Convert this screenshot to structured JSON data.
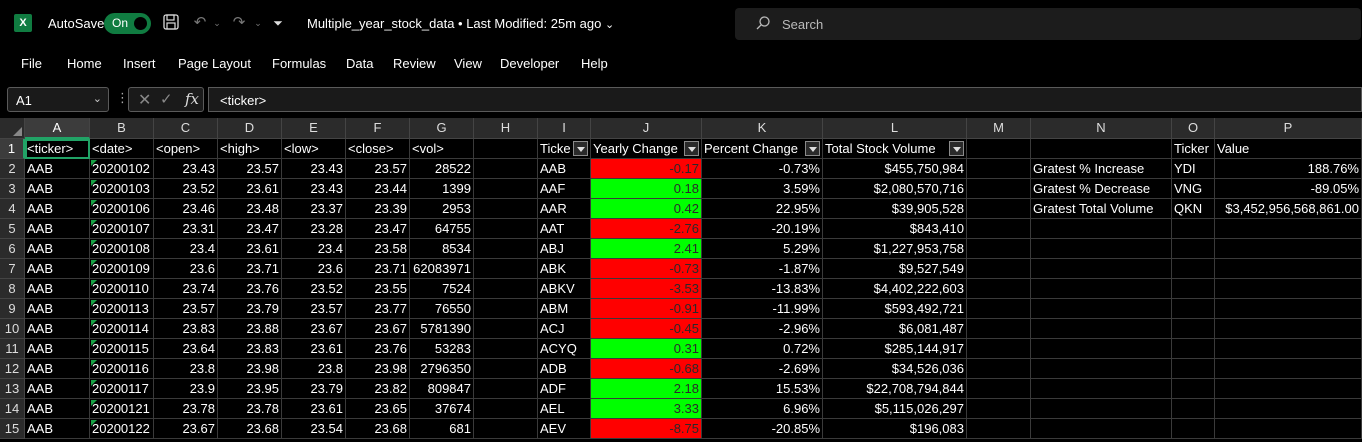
{
  "titlebar": {
    "app_logo": "X",
    "autosave_label": "AutoSave",
    "autosave_state": "On",
    "doc_title": "Multiple_year_stock_data • Last Modified: 25m ago",
    "search_placeholder": "Search",
    "icons": [
      "excel-logo",
      "save-icon",
      "undo-icon",
      "redo-icon",
      "customize-qat-icon",
      "search-icon"
    ]
  },
  "menu": [
    "File",
    "Home",
    "Insert",
    "Page Layout",
    "Formulas",
    "Data",
    "Review",
    "View",
    "Developer",
    "Help"
  ],
  "formula_bar": {
    "name_box": "A1",
    "formula": "<ticker>"
  },
  "grid": {
    "columns": [
      "A",
      "B",
      "C",
      "D",
      "E",
      "F",
      "G",
      "H",
      "I",
      "J",
      "K",
      "L",
      "M",
      "N",
      "O",
      "P"
    ],
    "rows": [
      "1",
      "2",
      "3",
      "4",
      "5",
      "6",
      "7",
      "8",
      "9",
      "10",
      "11",
      "12",
      "13",
      "14",
      "15"
    ],
    "raw_header": [
      "<ticker>",
      "<date>",
      "<open>",
      "<high>",
      "<low>",
      "<close>",
      "<vol>"
    ],
    "raw_rows": [
      [
        "AAB",
        "20200102",
        "23.43",
        "23.57",
        "23.43",
        "23.57",
        "28522"
      ],
      [
        "AAB",
        "20200103",
        "23.52",
        "23.61",
        "23.43",
        "23.44",
        "1399"
      ],
      [
        "AAB",
        "20200106",
        "23.46",
        "23.48",
        "23.37",
        "23.39",
        "2953"
      ],
      [
        "AAB",
        "20200107",
        "23.31",
        "23.47",
        "23.28",
        "23.47",
        "64755"
      ],
      [
        "AAB",
        "20200108",
        "23.4",
        "23.61",
        "23.4",
        "23.58",
        "8534"
      ],
      [
        "AAB",
        "20200109",
        "23.6",
        "23.71",
        "23.6",
        "23.71",
        "62083971"
      ],
      [
        "AAB",
        "20200110",
        "23.74",
        "23.76",
        "23.52",
        "23.55",
        "7524"
      ],
      [
        "AAB",
        "20200113",
        "23.57",
        "23.79",
        "23.57",
        "23.77",
        "76550"
      ],
      [
        "AAB",
        "20200114",
        "23.83",
        "23.88",
        "23.67",
        "23.67",
        "5781390"
      ],
      [
        "AAB",
        "20200115",
        "23.64",
        "23.83",
        "23.61",
        "23.76",
        "53283"
      ],
      [
        "AAB",
        "20200116",
        "23.8",
        "23.98",
        "23.8",
        "23.98",
        "2796350"
      ],
      [
        "AAB",
        "20200117",
        "23.9",
        "23.95",
        "23.79",
        "23.82",
        "809847"
      ],
      [
        "AAB",
        "20200121",
        "23.78",
        "23.78",
        "23.61",
        "23.65",
        "37674"
      ],
      [
        "AAB",
        "20200122",
        "23.67",
        "23.68",
        "23.54",
        "23.68",
        "681"
      ]
    ],
    "summary_header": [
      "Ticke",
      "Yearly Change",
      "Percent Change",
      "Total Stock Volume"
    ],
    "summary_rows": [
      {
        "ticker": "AAB",
        "change": "-0.17",
        "pct": "-0.73%",
        "vol": "$455,750,984",
        "positive": false
      },
      {
        "ticker": "AAF",
        "change": "0.18",
        "pct": "3.59%",
        "vol": "$2,080,570,716",
        "positive": true
      },
      {
        "ticker": "AAR",
        "change": "0.42",
        "pct": "22.95%",
        "vol": "$39,905,528",
        "positive": true
      },
      {
        "ticker": "AAT",
        "change": "-2.76",
        "pct": "-20.19%",
        "vol": "$843,410",
        "positive": false
      },
      {
        "ticker": "ABJ",
        "change": "2.41",
        "pct": "5.29%",
        "vol": "$1,227,953,758",
        "positive": true
      },
      {
        "ticker": "ABK",
        "change": "-0.73",
        "pct": "-1.87%",
        "vol": "$9,527,549",
        "positive": false
      },
      {
        "ticker": "ABKV",
        "change": "-3.53",
        "pct": "-13.83%",
        "vol": "$4,402,222,603",
        "positive": false
      },
      {
        "ticker": "ABM",
        "change": "-0.91",
        "pct": "-11.99%",
        "vol": "$593,492,721",
        "positive": false
      },
      {
        "ticker": "ACJ",
        "change": "-0.45",
        "pct": "-2.96%",
        "vol": "$6,081,487",
        "positive": false
      },
      {
        "ticker": "ACYQ",
        "change": "0.31",
        "pct": "0.72%",
        "vol": "$285,144,917",
        "positive": true
      },
      {
        "ticker": "ADB",
        "change": "-0.68",
        "pct": "-2.69%",
        "vol": "$34,526,036",
        "positive": false
      },
      {
        "ticker": "ADF",
        "change": "2.18",
        "pct": "15.53%",
        "vol": "$22,708,794,844",
        "positive": true
      },
      {
        "ticker": "AEL",
        "change": "3.33",
        "pct": "6.96%",
        "vol": "$5,115,026,297",
        "positive": true
      },
      {
        "ticker": "AEV",
        "change": "-8.75",
        "pct": "-20.85%",
        "vol": "$196,083",
        "positive": false
      }
    ],
    "greatest_header": [
      "",
      "Ticker",
      "Value"
    ],
    "greatest_rows": [
      [
        "Gratest % Increase",
        "YDI",
        "188.76%"
      ],
      [
        "Gratest % Decrease",
        "VNG",
        "-89.05%"
      ],
      [
        "Gratest Total Volume",
        "QKN",
        "$3,452,956,568,861.00"
      ]
    ]
  },
  "colors": {
    "positive_fill": "#00ff00",
    "negative_fill": "#ff0000",
    "excel_green": "#107c41",
    "selection": "#21a366"
  }
}
